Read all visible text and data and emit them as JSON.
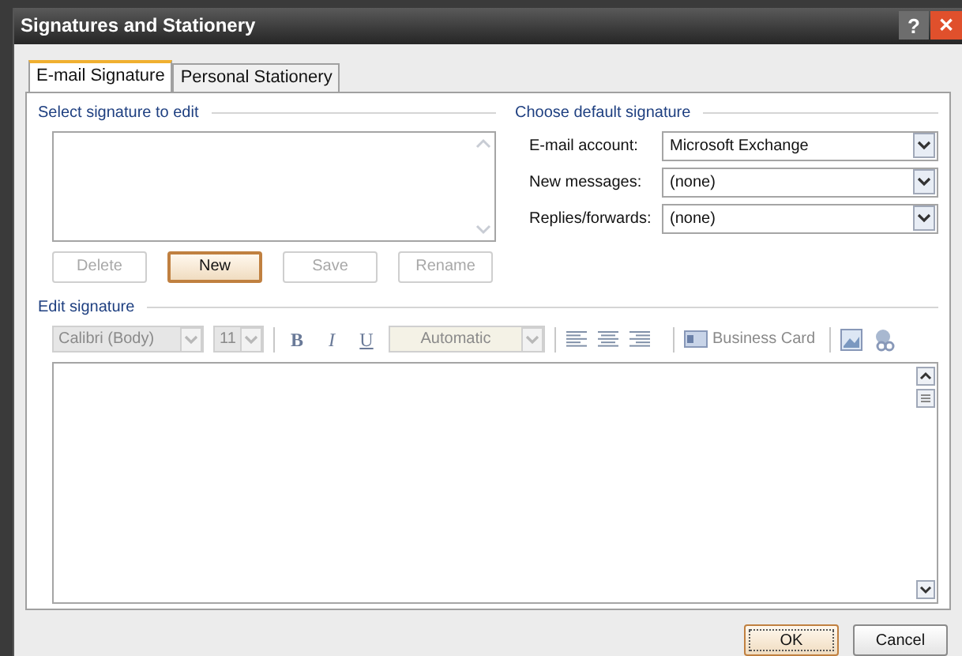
{
  "window": {
    "title": "Signatures and Stationery",
    "help": "?",
    "close": "✕"
  },
  "tabs": [
    {
      "label": "E-mail Signature",
      "selected": true
    },
    {
      "label": "Personal Stationery",
      "selected": false
    }
  ],
  "select_section": {
    "title": "Select signature to edit",
    "buttons": [
      {
        "label": "Delete",
        "disabled": true,
        "default": false
      },
      {
        "label": "New",
        "disabled": false,
        "default": true
      },
      {
        "label": "Save",
        "disabled": true,
        "default": false
      },
      {
        "label": "Rename",
        "disabled": true,
        "default": false
      }
    ]
  },
  "default_section": {
    "title": "Choose default signature",
    "fields": [
      {
        "label": "E-mail account:",
        "value": "Microsoft Exchange"
      },
      {
        "label": "New messages:",
        "value": "(none)"
      },
      {
        "label": "Replies/forwards:",
        "value": "(none)"
      }
    ]
  },
  "edit_section": {
    "title": "Edit signature",
    "toolbar": {
      "font": "Calibri (Body)",
      "size": "11",
      "bold": "B",
      "italic": "I",
      "underline": "U",
      "font_color_setting": "Automatic",
      "business_card": "Business Card",
      "disabled": true
    }
  },
  "buttons": [
    {
      "label": "OK",
      "default": true
    },
    {
      "label": "Cancel",
      "default": false
    }
  ]
}
